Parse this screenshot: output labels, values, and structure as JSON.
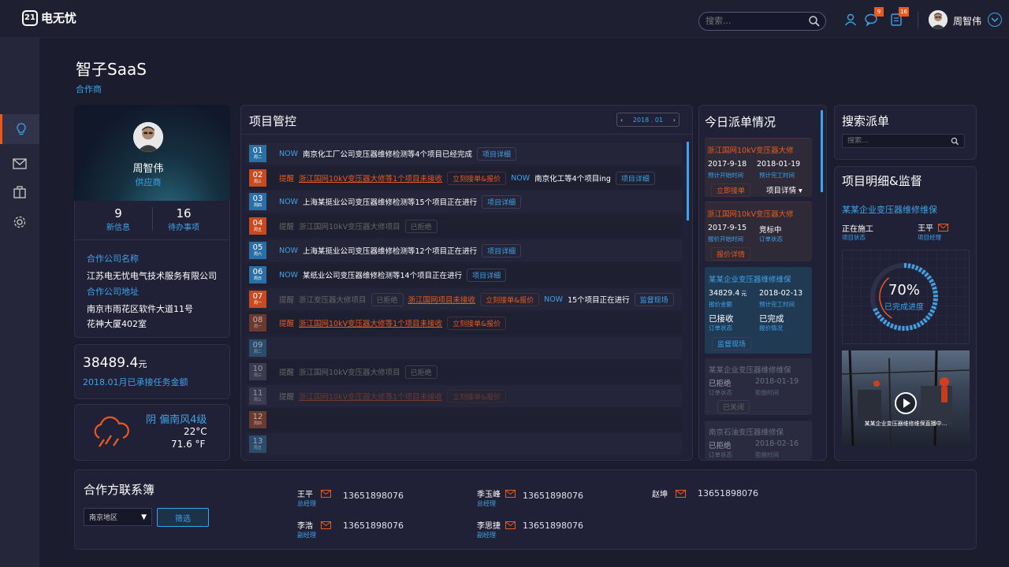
{
  "app": {
    "logo": "电无忧"
  },
  "header": {
    "search_placeholder": "搜索...",
    "messages_badge": "9",
    "tasks_badge": "16",
    "user_name": "周智伟"
  },
  "page": {
    "title": "智子SaaS",
    "subtitle": "合作商"
  },
  "profile": {
    "name": "周智伟",
    "role": "供应商",
    "new_info_count": "9",
    "new_info_label": "新信息",
    "todo_count": "16",
    "todo_label": "待办事项",
    "company_label": "合作公司名称",
    "company_name": "江苏电无忧电气技术服务有限公司",
    "address_label": "合作公司地址",
    "address_line1": "南京市雨花区软件大道11号",
    "address_line2": "花神大厦402室"
  },
  "amount": {
    "value": "38489.4",
    "unit": "元",
    "label": "2018.01月已承接任务金额"
  },
  "weather": {
    "desc": "阴 偏南风4级",
    "temp_c": "22°C",
    "temp_f": "71.6 °F"
  },
  "projects": {
    "title": "项目管控",
    "date": "2018 . 01",
    "rows": [
      {
        "day": "01",
        "wd": "周二"
      },
      {
        "day": "02",
        "wd": "周三"
      },
      {
        "day": "03",
        "wd": "周四"
      },
      {
        "day": "04",
        "wd": "周五"
      },
      {
        "day": "05",
        "wd": "周六"
      },
      {
        "day": "06",
        "wd": "周日"
      },
      {
        "day": "07",
        "wd": "周一"
      },
      {
        "day": "08",
        "wd": "周一"
      },
      {
        "day": "09",
        "wd": "周二"
      },
      {
        "day": "10",
        "wd": "周三"
      },
      {
        "day": "11",
        "wd": "周三"
      },
      {
        "day": "12",
        "wd": "周四"
      },
      {
        "day": "13",
        "wd": "周五"
      }
    ],
    "t_now": "NOW",
    "t_tip": "提醒",
    "r1_desc": "南京化工厂公司变压器维修检测等4个项目已经完成",
    "btn_detail": "项目详细",
    "btn_detail2": "项目详细",
    "r2_desc": "浙江国网10kV变压器大修等1个项目未接收",
    "btn_accept": "立刻接单&报价",
    "r2_now_desc": "南京化工等4个项目ing",
    "r3_desc": "上海某挺业公司变压器维修检测等15个项目正在进行",
    "r4_desc": "浙江国网10kV变压器大修项目",
    "btn_refused": "已拒绝",
    "r5_desc": "上海某挺业公司变压器维修检测等12个项目正在进行",
    "r6_desc": "某纸业公司变压器维修检测等14个项目正在进行",
    "r7_desc": "浙江变压器大修项目",
    "r7_red": "浙江国网项目未接收",
    "r7_now_desc": "15个项目正在进行",
    "btn_supervise": "监督现场",
    "r8_desc": "浙江国网10kV变压器大修等1个项目未接收",
    "r10_desc": "浙江国网10kV变压器大修项目",
    "r11_desc": "浙江国网10kV变压器大修等1个项目未接收"
  },
  "dispatch": {
    "title": "今日派单情况",
    "c1_title": "浙江国网10kV变压器大修",
    "c1_d1": "2017-9-18",
    "c1_l1": "预计开始时间",
    "c1_d2": "2018-01-19",
    "c1_l2": "预计完工时间",
    "c1_btn": "立即接单",
    "c1_link": "项目详情 ▾",
    "c2_title": "浙江国网10kV变压器大修",
    "c2_d1": "2017-9-15",
    "c2_l1": "报价开始时间",
    "c2_s": "竞标中",
    "c2_sl": "订单状态",
    "c2_btn": "报价详情",
    "c3_title": "某某企业变压器维修维保",
    "c3_amount": "34829.4",
    "c3_unit": "元",
    "c3_l1": "报价金额",
    "c3_d2": "2018-02-13",
    "c3_l2": "预计完工时间",
    "c3_s1": "已接收",
    "c3_sl1": "订单状态",
    "c3_s2": "已完成",
    "c3_sl2": "报价情况",
    "c3_btn": "监督现场",
    "c4_title": "某某企业变压器维修维保",
    "c4_s": "已拒绝",
    "c4_sl": "订单状态",
    "c4_d": "2018-01-19",
    "c4_dl": "拒绝时间",
    "c4_btn": "已关闭",
    "c5_title": "南京石油变压器维修保",
    "c5_s": "已拒绝",
    "c5_sl": "订单状态",
    "c5_d": "2018-02-16",
    "c5_dl": "拒绝时间"
  },
  "search_dispatch": {
    "title": "搜索派单",
    "placeholder": "搜索..."
  },
  "monitor": {
    "title": "项目明细&监督",
    "project": "某某企业变压器维修维保",
    "status": "正在施工",
    "status_label": "项目状态",
    "manager": "王平",
    "manager_label": "项目经理",
    "progress": 70,
    "progress_text": "70%",
    "progress_label": "已完成进度",
    "video_caption": "某某企业变压器维修维保直播中..."
  },
  "contacts": {
    "title": "合作方联系簿",
    "region": "南京地区",
    "filter_btn": "筛选",
    "c1_name": "王平",
    "c1_role": "总经理",
    "c1_phone": "13651898076",
    "c2_name": "季玉峰",
    "c2_role": "总经理",
    "c2_phone": "13651898076",
    "c3_name": "赵坤",
    "c3_phone": "13651898076",
    "c4_name": "李浩",
    "c4_role": "副经理",
    "c4_phone": "13651898076",
    "c5_name": "李思捷",
    "c5_role": "副经理",
    "c5_phone": "13651898076"
  },
  "colors": {
    "accent_blue": "#3fa3e8",
    "accent_orange": "#e85a1e",
    "bg": "#1b1c2e"
  }
}
